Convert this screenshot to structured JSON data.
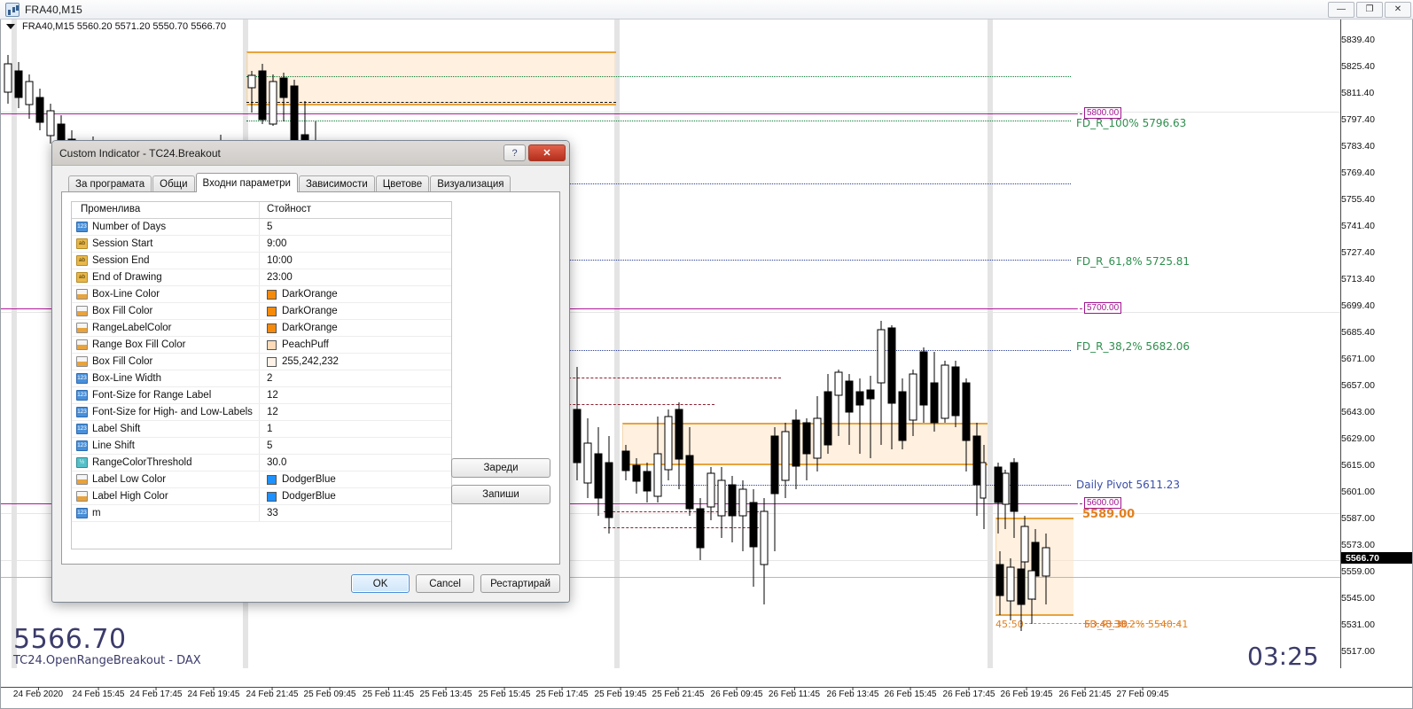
{
  "window": {
    "title": "FRA40,M15",
    "icon": "chart-window-icon",
    "minimize_label": "—",
    "maximize_label": "❐",
    "close_label": "✕"
  },
  "chart": {
    "ohlc_line": "FRA40,M15  5560.20 5571.20 5550.70 5566.70",
    "symbol": "FRA40,M15",
    "open": "5560.20",
    "high": "5571.20",
    "low": "5550.70",
    "close": "5566.70",
    "big_price": "5566.70",
    "sub_label": "TC24.OpenRangeBreakout - DAX",
    "clock": "03:25",
    "current_price_tag": "5566.70",
    "price_ticks": [
      "5839.40",
      "5825.40",
      "5811.40",
      "5797.40",
      "5783.40",
      "5769.40",
      "5755.40",
      "5741.40",
      "5727.40",
      "5713.40",
      "5699.40",
      "5685.40",
      "5671.00",
      "5657.00",
      "5643.00",
      "5629.00",
      "5615.00",
      "5601.00",
      "5587.00",
      "5573.00",
      "5559.00",
      "5545.00",
      "5531.00",
      "5517.00"
    ],
    "time_ticks": [
      "24 Feb 2020",
      "24 Feb 15:45",
      "24 Feb 17:45",
      "24 Feb 19:45",
      "24 Feb 21:45",
      "25 Feb 09:45",
      "25 Feb 11:45",
      "25 Feb 13:45",
      "25 Feb 15:45",
      "25 Feb 17:45",
      "25 Feb 19:45",
      "25 Feb 21:45",
      "26 Feb 09:45",
      "26 Feb 11:45",
      "26 Feb 13:45",
      "26 Feb 15:45",
      "26 Feb 17:45",
      "26 Feb 19:45",
      "26 Feb 21:45",
      "27 Feb 09:45"
    ],
    "price_tags": [
      "5800.00",
      "5700.00",
      "5600.00"
    ],
    "annotations": {
      "fib_100": "FD_R_100% 5796.63",
      "fib_618": "FD_R_61,8% 5725.81",
      "fib_382": "FD_R_38,2% 5682.06",
      "daily_pivot": "Daily Pivot 5611.23",
      "range_high": "5589.00",
      "range_time": "45:50",
      "fib_low_overlap": "FD_R_38,2% 5540.41",
      "fib_low_overlap2": "53.43.30"
    },
    "colors": {
      "range_line": "#e8a33d",
      "range_fill": "#ffe4c4",
      "magenta_line": "#b0179b",
      "fib_green": "#2f8f4e",
      "pivot_blue": "#3b4fa8",
      "orange_label": "#e08020",
      "price_text": "#3b3b6b"
    }
  },
  "dialog": {
    "title": "Custom Indicator - TC24.Breakout",
    "help_label": "?",
    "close_label": "✕",
    "tabs": [
      {
        "label": "За програмата",
        "active": false
      },
      {
        "label": "Общи",
        "active": false
      },
      {
        "label": "Входни параметри",
        "active": true
      },
      {
        "label": "Зависимости",
        "active": false
      },
      {
        "label": "Цветове",
        "active": false
      },
      {
        "label": "Визуализация",
        "active": false
      }
    ],
    "grid": {
      "headers": [
        "Променлива",
        "Стойност"
      ],
      "rows": [
        {
          "type": "num",
          "type_glyph": "123",
          "name": "Number of Days",
          "value": "5",
          "swatch": null
        },
        {
          "type": "str",
          "type_glyph": "ab",
          "name": "Session Start",
          "value": "9:00",
          "swatch": null
        },
        {
          "type": "str",
          "type_glyph": "ab",
          "name": "Session End",
          "value": "10:00",
          "swatch": null
        },
        {
          "type": "str",
          "type_glyph": "ab",
          "name": "End of Drawing",
          "value": "23:00",
          "swatch": null
        },
        {
          "type": "col",
          "type_glyph": "",
          "name": "Box-Line Color",
          "value": "DarkOrange",
          "swatch": "#F58A0B"
        },
        {
          "type": "col",
          "type_glyph": "",
          "name": "Box Fill Color",
          "value": "DarkOrange",
          "swatch": "#F58A0B"
        },
        {
          "type": "col",
          "type_glyph": "",
          "name": "RangeLabelColor",
          "value": "DarkOrange",
          "swatch": "#F58A0B"
        },
        {
          "type": "col",
          "type_glyph": "",
          "name": "Range Box Fill Color",
          "value": "PeachPuff",
          "swatch": "#FFDAB9"
        },
        {
          "type": "col",
          "type_glyph": "",
          "name": "Box Fill Color",
          "value": "255,242,232",
          "swatch": "#FFF2E8"
        },
        {
          "type": "num",
          "type_glyph": "123",
          "name": "Box-Line Width",
          "value": "2",
          "swatch": null
        },
        {
          "type": "num",
          "type_glyph": "123",
          "name": "Font-Size for Range Label",
          "value": "12",
          "swatch": null
        },
        {
          "type": "num",
          "type_glyph": "123",
          "name": "Font-Size for High- and Low-Labels",
          "value": "12",
          "swatch": null
        },
        {
          "type": "num",
          "type_glyph": "123",
          "name": "Label Shift",
          "value": "1",
          "swatch": null
        },
        {
          "type": "num",
          "type_glyph": "123",
          "name": "Line Shift",
          "value": "5",
          "swatch": null
        },
        {
          "type": "flt",
          "type_glyph": "½",
          "name": "RangeColorThreshold",
          "value": "30.0",
          "swatch": null
        },
        {
          "type": "col",
          "type_glyph": "",
          "name": "Label Low Color",
          "value": "DodgerBlue",
          "swatch": "#1E90FF"
        },
        {
          "type": "col",
          "type_glyph": "",
          "name": "Label High Color",
          "value": "DodgerBlue",
          "swatch": "#1E90FF"
        },
        {
          "type": "num",
          "type_glyph": "123",
          "name": "m",
          "value": "33",
          "swatch": null
        }
      ]
    },
    "side_buttons": [
      {
        "label": "Зареди"
      },
      {
        "label": "Запиши"
      }
    ],
    "footer_buttons": [
      {
        "label": "OK",
        "primary": true
      },
      {
        "label": "Cancel",
        "primary": false
      },
      {
        "label": "Рестартирай",
        "primary": false
      }
    ]
  }
}
